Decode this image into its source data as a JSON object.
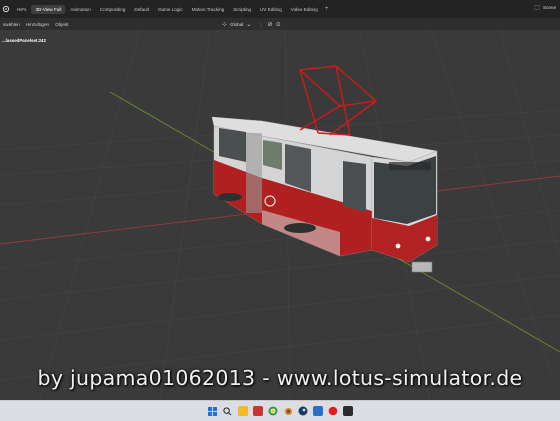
{
  "workspaces": {
    "tabs": [
      {
        "label": "HiFs",
        "active": false
      },
      {
        "label": "3D-View Full",
        "active": true
      },
      {
        "label": "Animation",
        "active": false
      },
      {
        "label": "Compositing",
        "active": false
      },
      {
        "label": "Default",
        "active": false
      },
      {
        "label": "Game Logic",
        "active": false
      },
      {
        "label": "Motion Tracking",
        "active": false
      },
      {
        "label": "Scripting",
        "active": false
      },
      {
        "label": "UV Editing",
        "active": false
      },
      {
        "label": "Video Editing",
        "active": false
      }
    ],
    "add_label": "+",
    "scene_label": "Scene"
  },
  "header": {
    "menus": [
      "swählen",
      "Hinzufügen",
      "Objekt"
    ],
    "orientation": "Global"
  },
  "viewport": {
    "object_name": "...lassedPanelset.242"
  },
  "watermark": "by jupama01062013 - www.lotus-simulator.de",
  "taskbar": {
    "icons": [
      {
        "name": "windows-start-icon",
        "color": "#1e73d8"
      },
      {
        "name": "search-icon",
        "color": "#333333"
      },
      {
        "name": "file-explorer-icon",
        "color": "#f2b928"
      },
      {
        "name": "photos-icon",
        "color": "#c8342f"
      },
      {
        "name": "chrome-icon",
        "color": "#2f9c47"
      },
      {
        "name": "blender-icon",
        "color": "#e87d0d"
      },
      {
        "name": "steam-icon",
        "color": "#1b3b5c"
      },
      {
        "name": "folder-icon",
        "color": "#2a6ec7"
      },
      {
        "name": "recording-icon",
        "color": "#e01e1e"
      },
      {
        "name": "terminal-icon",
        "color": "#2b2b2b"
      }
    ]
  }
}
